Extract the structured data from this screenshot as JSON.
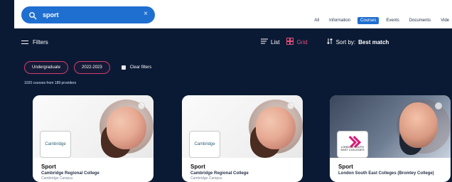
{
  "topbar": {
    "search_value": "sport",
    "tabs": [
      "All",
      "Information",
      "Courses",
      "Events",
      "Documents",
      "Vide"
    ],
    "active_tab_index": 2
  },
  "filterbar": {
    "filters_label": "Filters",
    "list_label": "List",
    "grid_label": "Grid",
    "sort_prefix": "Sort by:",
    "sort_value": "Best match"
  },
  "chips": {
    "items": [
      "Undergraduate",
      "2022-2023"
    ],
    "clear_label": "Clear filters"
  },
  "results": {
    "count_text": "1020 courses from 189 providers"
  },
  "cards": [
    {
      "title": "Sport",
      "provider": "Cambridge Regional College",
      "campus": "Cambridge Campus",
      "logo_text": "Cambridge"
    },
    {
      "title": "Sport",
      "provider": "Cambridge Regional College",
      "campus": "Cambridge Campus",
      "logo_text": "Cambridge"
    },
    {
      "title": "Sport",
      "provider": "London South East Colleges (Bromley College)",
      "campus": "",
      "logo_text": "LONDON SOUTH EAST COLLEGES"
    }
  ],
  "colors": {
    "background": "#0b1a34",
    "primary_blue": "#1f6fd1",
    "pink": "#d23b6b"
  }
}
